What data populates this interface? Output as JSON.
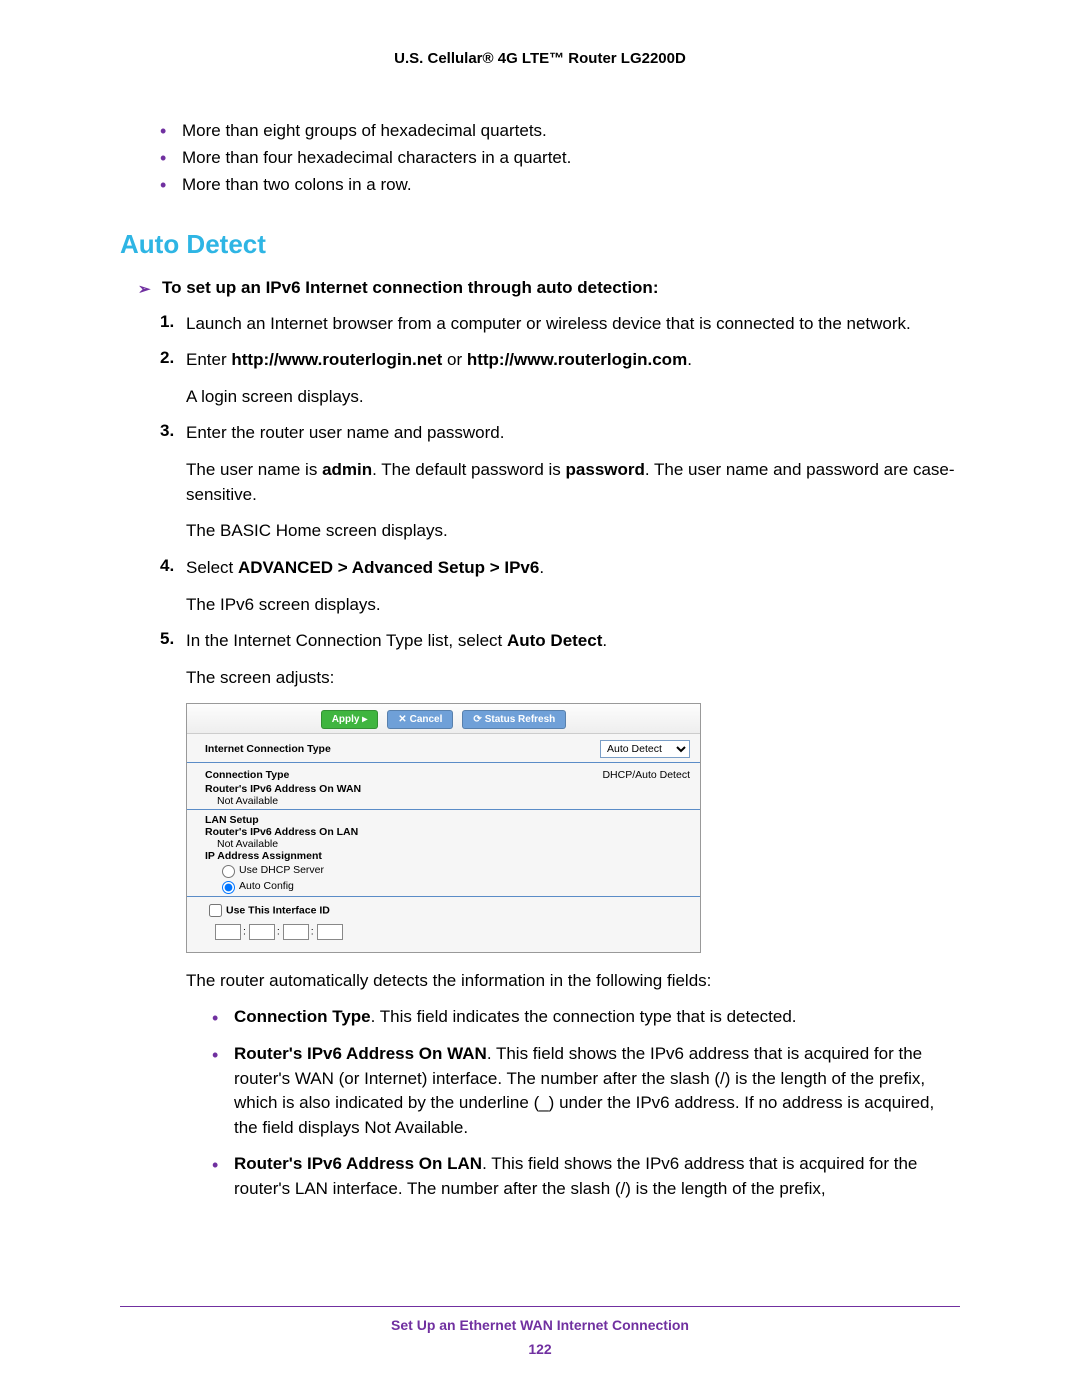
{
  "header": {
    "title": "U.S. Cellular® 4G LTE™ Router LG2200D"
  },
  "top_bullets": [
    "More than eight groups of hexadecimal quartets.",
    "More than four hexadecimal characters in a quartet.",
    "More than two colons in a row."
  ],
  "section_heading": "Auto Detect",
  "task": "To set up an IPv6 Internet connection through auto detection:",
  "steps": {
    "s1": {
      "num": "1.",
      "text": "Launch an Internet browser from a computer or wireless device that is connected to the network."
    },
    "s2": {
      "num": "2.",
      "prefix": "Enter ",
      "url1": "http://www.routerlogin.net",
      "mid": " or ",
      "url2": "http://www.routerlogin.com",
      "suffix": ".",
      "after": "A login screen displays."
    },
    "s3": {
      "num": "3.",
      "line": "Enter the router user name and password.",
      "p1a": "The user name is ",
      "p1b": "admin",
      "p1c": ". The default password is ",
      "p1d": "password",
      "p1e": ". The user name and password are case-sensitive.",
      "p2": "The BASIC Home screen displays."
    },
    "s4": {
      "num": "4.",
      "prefix": "Select ",
      "path": "ADVANCED > Advanced Setup > IPv6",
      "suffix": ".",
      "after": "The IPv6 screen displays."
    },
    "s5": {
      "num": "5.",
      "prefix": "In the Internet Connection Type list, select ",
      "bold": "Auto Detect",
      "suffix": ".",
      "after": "The screen adjusts:"
    }
  },
  "router_ui": {
    "apply": "Apply ▸",
    "cancel": "Cancel",
    "refresh": "Status Refresh",
    "ict_label": "Internet Connection Type",
    "ict_value": "Auto Detect",
    "conn_type_label": "Connection Type",
    "conn_type_value": "DHCP/Auto Detect",
    "wan_label": "Router's IPv6 Address On WAN",
    "not_available": "Not Available",
    "lan_setup": "LAN Setup",
    "lan_label": "Router's IPv6 Address On LAN",
    "ipaa": "IP Address Assignment",
    "dhcp": "Use DHCP Server",
    "auto": "Auto Config",
    "iface": "Use This Interface ID"
  },
  "after_ui_intro": "The router automatically detects the information in the following fields:",
  "fields": {
    "f1": {
      "b": "Connection Type",
      "rest": ". This field indicates the connection type that is detected."
    },
    "f2": {
      "b": "Router's IPv6 Address On WAN",
      "rest": ". This field shows the IPv6 address that is acquired for the router's WAN (or Internet) interface. The number after the slash (/) is the length of the prefix, which is also indicated by the underline (_) under the IPv6 address. If no address is acquired, the field displays Not Available."
    },
    "f3": {
      "b": "Router's IPv6 Address On LAN",
      "rest": ". This field shows the IPv6 address that is acquired for the router's LAN interface. The number after the slash (/) is the length of the prefix,"
    }
  },
  "footer": {
    "title": "Set Up an Ethernet WAN Internet Connection",
    "page": "122"
  }
}
